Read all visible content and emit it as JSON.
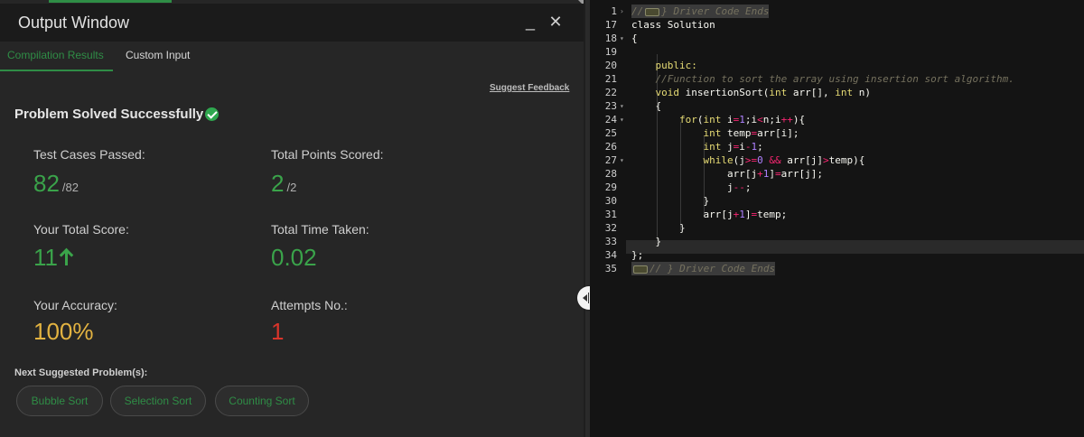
{
  "output_window": {
    "title": "Output Window",
    "minimize": "_",
    "close": "✕",
    "tabs": {
      "compilation": "Compilation Results",
      "custom": "Custom Input"
    },
    "suggest_feedback": "Suggest Feedback",
    "status": "Problem Solved Successfully",
    "stats": {
      "test_cases_label": "Test Cases Passed:",
      "test_cases_value": "82",
      "test_cases_total": "/82",
      "points_label": "Total Points Scored:",
      "points_value": "2",
      "points_total": "/2",
      "score_label": "Your Total Score:",
      "score_value": "11",
      "time_label": "Total Time Taken:",
      "time_value": "0.02",
      "accuracy_label": "Your Accuracy:",
      "accuracy_value": "100%",
      "attempts_label": "Attempts No.:",
      "attempts_value": "1"
    },
    "next_label": "Next Suggested Problem(s):",
    "suggestions": [
      "Bubble Sort",
      "Selection Sort",
      "Counting Sort"
    ]
  },
  "editor": {
    "lines": [
      {
        "n": "1",
        "fold": "›",
        "segments": [
          {
            "t": "//",
            "c": "cm"
          },
          {
            "t": "",
            "c": "box"
          },
          {
            "t": "} Driver Code Ends",
            "c": "cm"
          }
        ],
        "hl": true
      },
      {
        "n": "17",
        "fold": "",
        "segments": [
          {
            "t": "class Solution",
            "c": "tx"
          }
        ]
      },
      {
        "n": "18",
        "fold": "▾",
        "segments": [
          {
            "t": "{",
            "c": "tx"
          }
        ]
      },
      {
        "n": "19",
        "fold": "",
        "segments": []
      },
      {
        "n": "20",
        "fold": "",
        "segments": [
          {
            "t": "    ",
            "c": "tx"
          },
          {
            "t": "public:",
            "c": "kw"
          }
        ]
      },
      {
        "n": "21",
        "fold": "",
        "segments": [
          {
            "t": "    ",
            "c": "tx"
          },
          {
            "t": "//Function to sort the array using insertion sort algorithm.",
            "c": "cm"
          }
        ]
      },
      {
        "n": "22",
        "fold": "",
        "segments": [
          {
            "t": "    ",
            "c": "tx"
          },
          {
            "t": "void",
            "c": "kw"
          },
          {
            "t": " insertionSort(",
            "c": "tx"
          },
          {
            "t": "int",
            "c": "kw"
          },
          {
            "t": " arr[], ",
            "c": "tx"
          },
          {
            "t": "int",
            "c": "kw"
          },
          {
            "t": " n)",
            "c": "tx"
          }
        ]
      },
      {
        "n": "23",
        "fold": "▾",
        "segments": [
          {
            "t": "    {",
            "c": "tx"
          }
        ]
      },
      {
        "n": "24",
        "fold": "▾",
        "segments": [
          {
            "t": "        ",
            "c": "tx"
          },
          {
            "t": "for",
            "c": "kw"
          },
          {
            "t": "(",
            "c": "tx"
          },
          {
            "t": "int",
            "c": "kw"
          },
          {
            "t": " i",
            "c": "tx"
          },
          {
            "t": "=",
            "c": "op"
          },
          {
            "t": "1",
            "c": "num"
          },
          {
            "t": ";i",
            "c": "tx"
          },
          {
            "t": "<",
            "c": "op"
          },
          {
            "t": "n;i",
            "c": "tx"
          },
          {
            "t": "++",
            "c": "op"
          },
          {
            "t": "){",
            "c": "tx"
          }
        ]
      },
      {
        "n": "25",
        "fold": "",
        "segments": [
          {
            "t": "            ",
            "c": "tx"
          },
          {
            "t": "int",
            "c": "kw"
          },
          {
            "t": " temp",
            "c": "tx"
          },
          {
            "t": "=",
            "c": "op"
          },
          {
            "t": "arr[i];",
            "c": "tx"
          }
        ]
      },
      {
        "n": "26",
        "fold": "",
        "segments": [
          {
            "t": "            ",
            "c": "tx"
          },
          {
            "t": "int",
            "c": "kw"
          },
          {
            "t": " j",
            "c": "tx"
          },
          {
            "t": "=",
            "c": "op"
          },
          {
            "t": "i",
            "c": "tx"
          },
          {
            "t": "-",
            "c": "op"
          },
          {
            "t": "1",
            "c": "num"
          },
          {
            "t": ";",
            "c": "tx"
          }
        ]
      },
      {
        "n": "27",
        "fold": "▾",
        "segments": [
          {
            "t": "            ",
            "c": "tx"
          },
          {
            "t": "while",
            "c": "kw"
          },
          {
            "t": "(j",
            "c": "tx"
          },
          {
            "t": ">=",
            "c": "op"
          },
          {
            "t": "0",
            "c": "num"
          },
          {
            "t": " ",
            "c": "tx"
          },
          {
            "t": "&&",
            "c": "op"
          },
          {
            "t": " arr[j]",
            "c": "tx"
          },
          {
            "t": ">",
            "c": "op"
          },
          {
            "t": "temp){",
            "c": "tx"
          }
        ]
      },
      {
        "n": "28",
        "fold": "",
        "segments": [
          {
            "t": "                arr[j",
            "c": "tx"
          },
          {
            "t": "+",
            "c": "op"
          },
          {
            "t": "1",
            "c": "num"
          },
          {
            "t": "]",
            "c": "tx"
          },
          {
            "t": "=",
            "c": "op"
          },
          {
            "t": "arr[j];",
            "c": "tx"
          }
        ]
      },
      {
        "n": "29",
        "fold": "",
        "segments": [
          {
            "t": "                j",
            "c": "tx"
          },
          {
            "t": "--",
            "c": "op"
          },
          {
            "t": ";",
            "c": "tx"
          }
        ]
      },
      {
        "n": "30",
        "fold": "",
        "segments": [
          {
            "t": "            }",
            "c": "tx"
          }
        ]
      },
      {
        "n": "31",
        "fold": "",
        "segments": [
          {
            "t": "            arr[j",
            "c": "tx"
          },
          {
            "t": "+",
            "c": "op"
          },
          {
            "t": "1",
            "c": "num"
          },
          {
            "t": "]",
            "c": "tx"
          },
          {
            "t": "=",
            "c": "op"
          },
          {
            "t": "temp;",
            "c": "tx"
          }
        ]
      },
      {
        "n": "32",
        "fold": "",
        "segments": [
          {
            "t": "        }",
            "c": "tx"
          }
        ]
      },
      {
        "n": "33",
        "fold": "",
        "segments": [
          {
            "t": "    }",
            "c": "tx"
          }
        ]
      },
      {
        "n": "34",
        "fold": "",
        "segments": [
          {
            "t": "};",
            "c": "tx"
          }
        ]
      },
      {
        "n": "35",
        "fold": "",
        "segments": [
          {
            "t": "",
            "c": "box"
          },
          {
            "t": "// } Driver Code Ends",
            "c": "cm"
          }
        ],
        "hl": true
      }
    ]
  }
}
